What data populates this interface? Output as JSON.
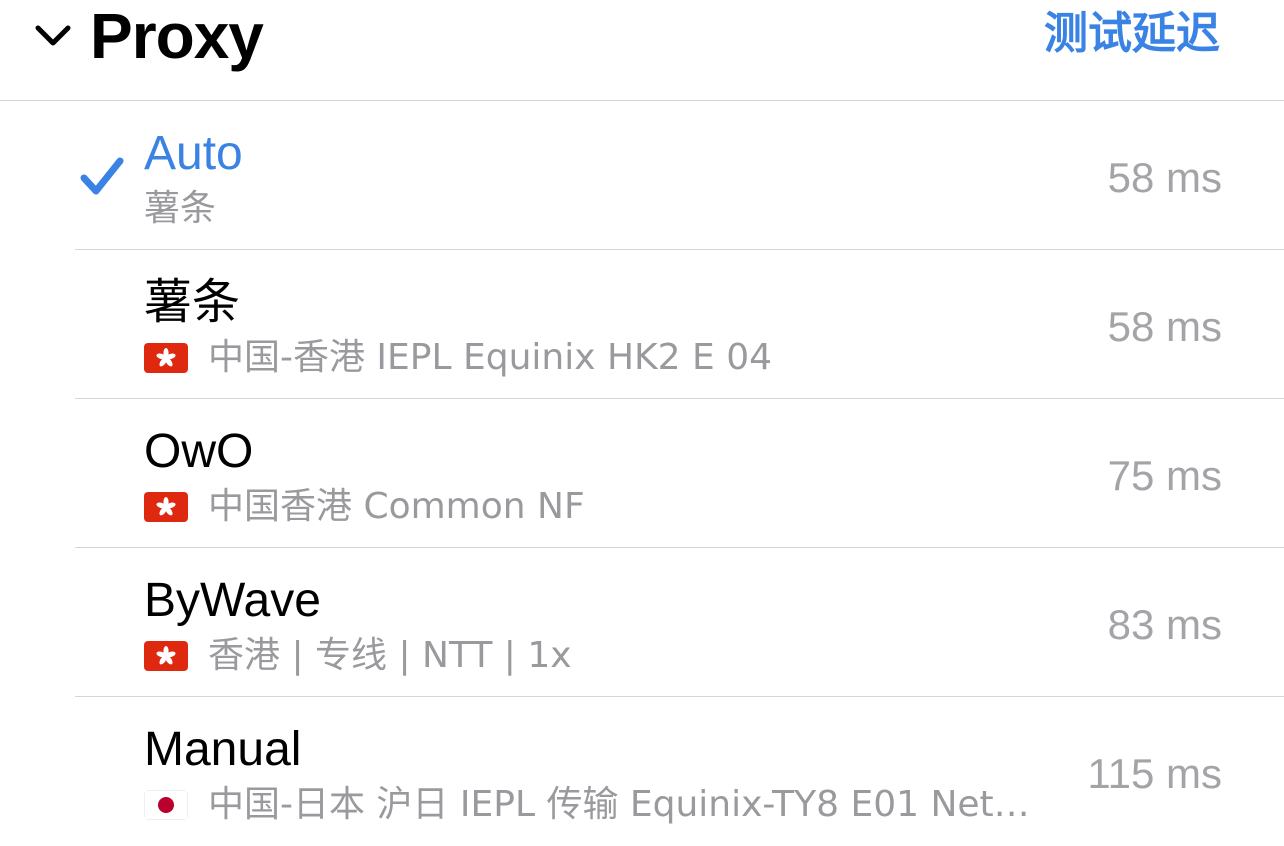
{
  "header": {
    "title": "Proxy",
    "collapse_icon": "chevron-down-icon",
    "test_latency_label": "测试延迟",
    "accent_color": "#3a83e4"
  },
  "proxies": [
    {
      "name": "Auto",
      "subtitle": "薯条",
      "latency": "58 ms",
      "selected": true,
      "flag": null
    },
    {
      "name": "薯条",
      "subtitle": "中国-香港 IEPL Equinix HK2 E 04",
      "latency": "58 ms",
      "selected": false,
      "flag": "hong-kong-flag-icon"
    },
    {
      "name": "OwO",
      "subtitle": "中国香港 Common NF",
      "latency": "75 ms",
      "selected": false,
      "flag": "hong-kong-flag-icon"
    },
    {
      "name": "ByWave",
      "subtitle": "香港 | 专线 | NTT | 1x",
      "latency": "83 ms",
      "selected": false,
      "flag": "hong-kong-flag-icon"
    },
    {
      "name": "Manual",
      "subtitle": "中国-日本 沪日 IEPL 传输 Equinix-TY8 E01 Net…",
      "latency": "115 ms",
      "selected": false,
      "flag": "japan-flag-icon"
    }
  ]
}
